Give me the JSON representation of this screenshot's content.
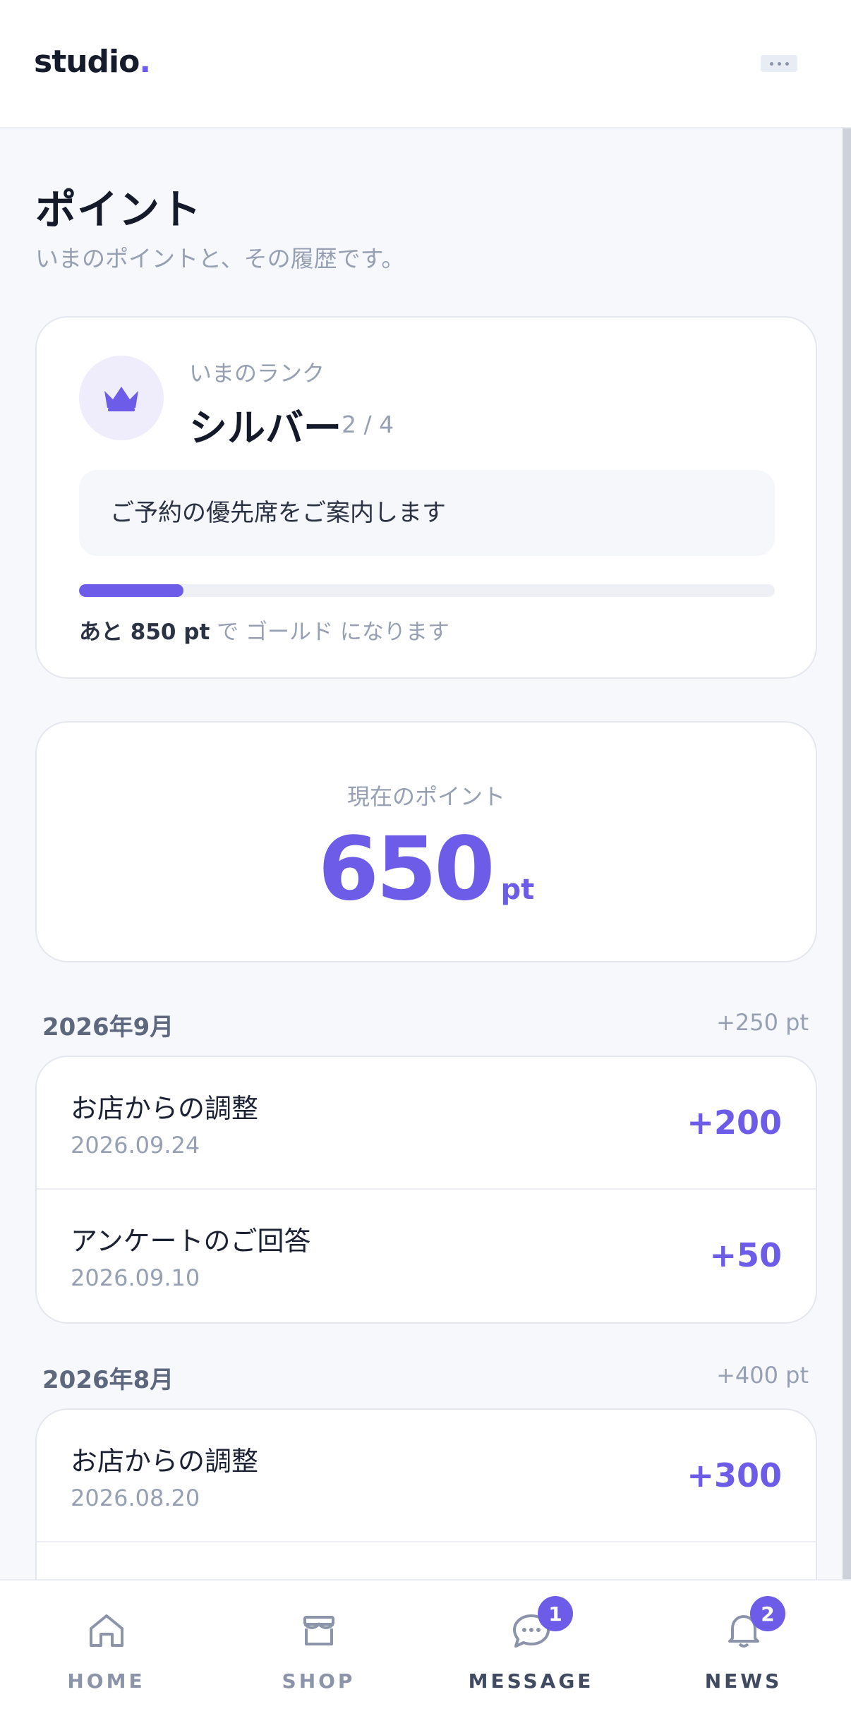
{
  "header": {
    "logo_text": "studio",
    "logo_dot": "."
  },
  "page": {
    "title": "ポイント",
    "subtitle": "いまのポイントと、その履歴です。"
  },
  "rank": {
    "label": "いまのランク",
    "name": "シルバー",
    "step": "2 / 4",
    "benefit": "ご予約の優先席をご案内します",
    "progress": 0.15,
    "remaining": "あと 850 pt",
    "remaining_suffix": " で ゴールド になります",
    "icon": "crown-icon"
  },
  "points": {
    "label": "現在のポイント",
    "value": "650",
    "unit": "pt"
  },
  "history": [
    {
      "month": "2026年9月",
      "total": "+250 pt",
      "items": [
        {
          "title": "お店からの調整",
          "date": "2026.09.24",
          "amount": "+200"
        },
        {
          "title": "アンケートのご回答",
          "date": "2026.09.10",
          "amount": "+50"
        }
      ]
    },
    {
      "month": "2026年8月",
      "total": "+400 pt",
      "items": [
        {
          "title": "お店からの調整",
          "date": "2026.08.20",
          "amount": "+300"
        }
      ]
    }
  ],
  "nav": [
    {
      "label": "HOME",
      "icon": "home-icon"
    },
    {
      "label": "SHOP",
      "icon": "shop-icon"
    },
    {
      "label": "MESSAGE",
      "icon": "message-icon",
      "badge": "1"
    },
    {
      "label": "NEWS",
      "icon": "bell-icon",
      "badge": "2"
    }
  ],
  "colors": {
    "accent": "#6c5ce7",
    "muted": "#97a0b3",
    "text": "#141a2a"
  }
}
